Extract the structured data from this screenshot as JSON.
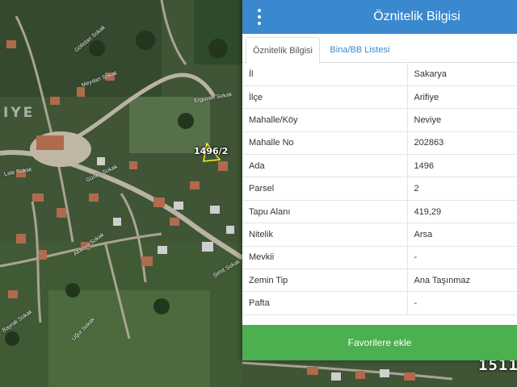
{
  "panel": {
    "title": "Öznitelik Bilgisi",
    "menu_icon": "vertical-dots-icon",
    "tabs": [
      {
        "label": "Öznitelik Bilgisi",
        "active": true
      },
      {
        "label": "Bina/BB Listesi",
        "active": false
      }
    ],
    "rows": [
      {
        "key": "İl",
        "value": "Sakarya"
      },
      {
        "key": "İlçe",
        "value": "Arifiye"
      },
      {
        "key": "Mahalle/Köy",
        "value": "Neviye"
      },
      {
        "key": "Mahalle No",
        "value": "202863"
      },
      {
        "key": "Ada",
        "value": "1496"
      },
      {
        "key": "Parsel",
        "value": "2"
      },
      {
        "key": "Tapu Alanı",
        "value": "419,29"
      },
      {
        "key": "Nitelik",
        "value": "Arsa"
      },
      {
        "key": "Mevkii",
        "value": "-"
      },
      {
        "key": "Zemin Tip",
        "value": "Ana Taşınmaz"
      },
      {
        "key": "Pafta",
        "value": "-"
      }
    ],
    "favorite_button": "Favorilere ekle"
  },
  "map": {
    "region_label": "IYE",
    "parcel_label": "1496/2",
    "corner_label": "1511",
    "street_labels": [
      "Gölistan Sokak",
      "Meydan Sokak",
      "Erguvan Sokak",
      "Güneş Sokak",
      "Lale Sokak",
      "Akasya Sokak",
      "Bayrak Sokak",
      "Şehit Sokak",
      "Uğur Sokak"
    ]
  },
  "colors": {
    "header": "#3a88cd",
    "tab_link": "#3a88cd",
    "favorite_button": "#4caf50"
  }
}
